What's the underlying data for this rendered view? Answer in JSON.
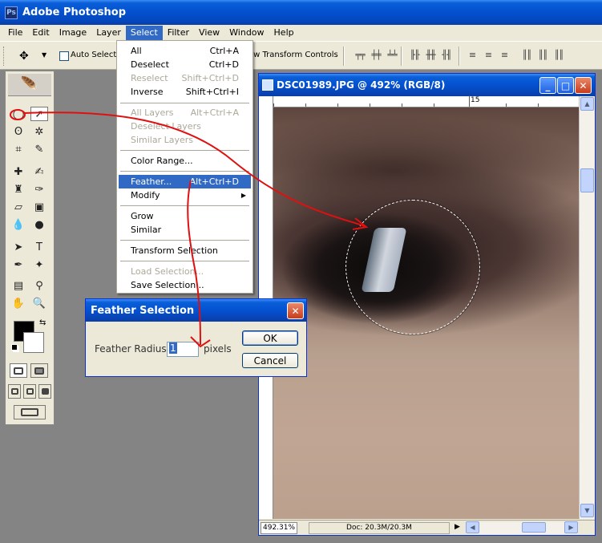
{
  "app": {
    "title": "Adobe Photoshop",
    "icon": "photoshop-icon"
  },
  "menubar": {
    "items": [
      "File",
      "Edit",
      "Image",
      "Layer",
      "Select",
      "Filter",
      "View",
      "Window",
      "Help"
    ],
    "active": "Select"
  },
  "options": {
    "auto_select": "Auto Select L",
    "show_transform": "ow Transform Controls"
  },
  "select_menu": {
    "items": [
      {
        "label": "All",
        "shortcut": "Ctrl+A",
        "enabled": true
      },
      {
        "label": "Deselect",
        "shortcut": "Ctrl+D",
        "enabled": true
      },
      {
        "label": "Reselect",
        "shortcut": "Shift+Ctrl+D",
        "enabled": false
      },
      {
        "label": "Inverse",
        "shortcut": "Shift+Ctrl+I",
        "enabled": true
      },
      {
        "label": "All Layers",
        "shortcut": "Alt+Ctrl+A",
        "enabled": false
      },
      {
        "label": "Deselect Layers",
        "shortcut": "",
        "enabled": false
      },
      {
        "label": "Similar Layers",
        "shortcut": "",
        "enabled": false
      },
      {
        "label": "Color Range...",
        "shortcut": "",
        "enabled": true
      },
      {
        "label": "Feather...",
        "shortcut": "Alt+Ctrl+D",
        "enabled": true,
        "highlighted": true
      },
      {
        "label": "Modify",
        "shortcut": "",
        "enabled": true,
        "submenu": true
      },
      {
        "label": "Grow",
        "shortcut": "",
        "enabled": true
      },
      {
        "label": "Similar",
        "shortcut": "",
        "enabled": true
      },
      {
        "label": "Transform Selection",
        "shortcut": "",
        "enabled": true
      },
      {
        "label": "Load Selection...",
        "shortcut": "",
        "enabled": false
      },
      {
        "label": "Save Selection...",
        "shortcut": "",
        "enabled": true
      }
    ]
  },
  "document": {
    "title": "DSC01989.JPG @ 492% (RGB/8)",
    "ruler_mark": "15",
    "zoom": "492.31%",
    "doc_info": "Doc: 20.3M/20.3M"
  },
  "dialog": {
    "title": "Feather Selection",
    "label": "Feather Radius:",
    "value": "1",
    "unit": "pixels",
    "ok": "OK",
    "cancel": "Cancel"
  },
  "colors": {
    "titlebar": "#0451d0",
    "menu_highlight": "#316ac5",
    "annotation": "#e01010"
  }
}
